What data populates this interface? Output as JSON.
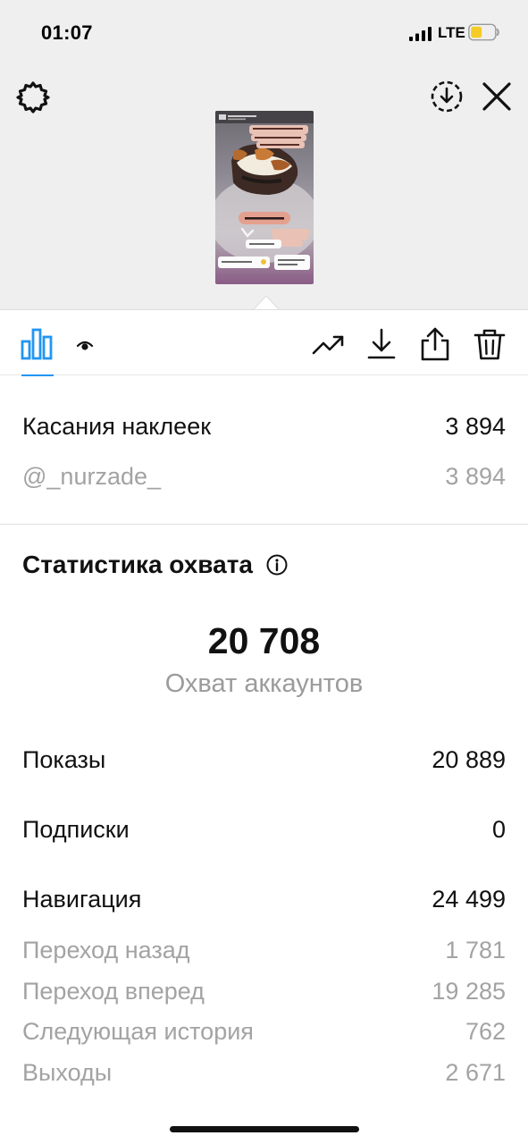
{
  "status_bar": {
    "time": "01:07",
    "network": "LTE"
  },
  "sticker_taps": {
    "title": "Касания наклеек",
    "title_value": "3 894",
    "items": [
      {
        "label": "@_nurzade_",
        "value": "3 894"
      }
    ]
  },
  "reach": {
    "title": "Статистика охвата",
    "number": "20 708",
    "label": "Охват аккаунтов",
    "metrics": [
      {
        "label": "Показы",
        "value": "20 889"
      },
      {
        "label": "Подписки",
        "value": "0"
      },
      {
        "label": "Навигация",
        "value": "24 499"
      }
    ],
    "navigation_items": [
      {
        "label": "Переход назад",
        "value": "1 781"
      },
      {
        "label": "Переход вперед",
        "value": "19 285"
      },
      {
        "label": "Следующая история",
        "value": "762"
      },
      {
        "label": "Выходы",
        "value": "2 671"
      }
    ]
  },
  "icons": {
    "settings": "gear-icon",
    "save": "download-circle-icon",
    "close": "close-icon",
    "stats_tab": "bar-chart-icon",
    "views_tab": "eye-icon",
    "promote": "trending-up-icon",
    "download": "download-icon",
    "share": "share-icon",
    "delete": "trash-icon"
  },
  "colors": {
    "accent": "#2196f3",
    "top_background": "#efefef",
    "secondary_text": "#a3a3a3"
  }
}
